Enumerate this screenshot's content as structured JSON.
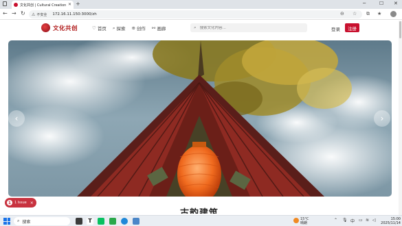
{
  "browser": {
    "tab_title": "文化共创 | Cultural Creation",
    "new_tab_symbol": "+",
    "not_secure_label": "不安全",
    "url": "172.16.11.150:3000/zh"
  },
  "site": {
    "logo_text": "文化共创",
    "nav": [
      {
        "label": "首页",
        "icon": "heart-icon"
      },
      {
        "label": "探索",
        "icon": "search-icon"
      },
      {
        "label": "创作",
        "icon": "plus-circle-icon"
      },
      {
        "label": "画廊",
        "icon": "link-icon"
      }
    ],
    "search_placeholder": "搜索文化内容...",
    "login_label": "登录",
    "register_label": "注册",
    "accent_color": "#c8102e"
  },
  "hero": {
    "prev_symbol": "‹",
    "next_symbol": "›"
  },
  "section_title": "古韵建筑",
  "issue_badge": {
    "count": "1",
    "label": "1 Issue",
    "close_symbol": "×"
  },
  "taskbar": {
    "search_label": "搜索",
    "weather_temp": "15°C",
    "weather_desc": "晴朗",
    "lang": "中",
    "time": "15:00",
    "date": "2025/11/14"
  }
}
